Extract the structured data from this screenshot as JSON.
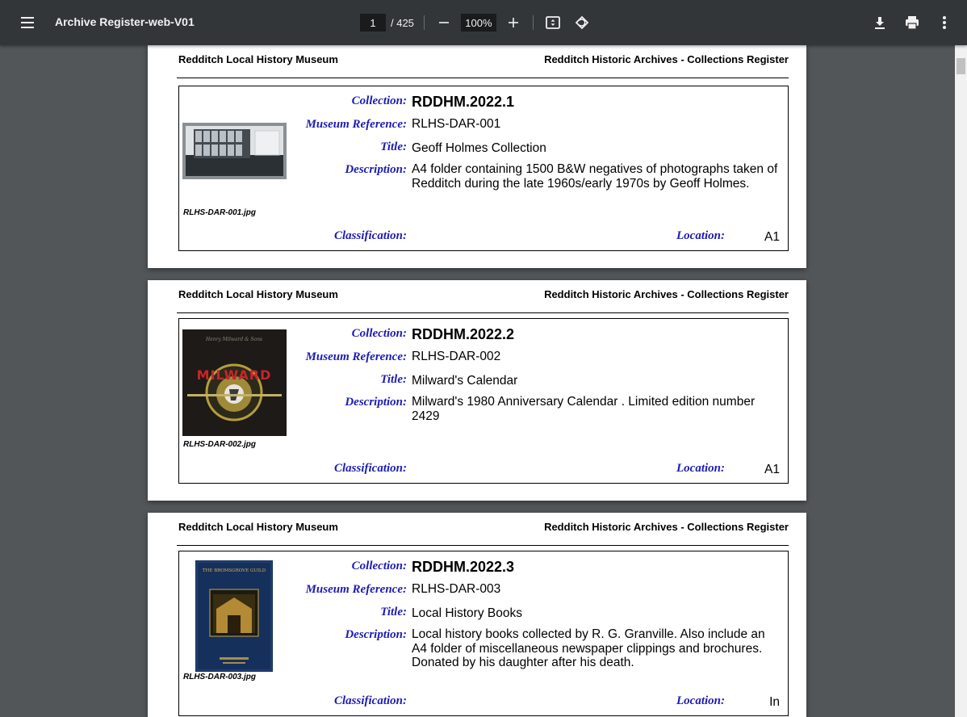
{
  "toolbar": {
    "title": "Archive Register-web-V01",
    "current_page": "1",
    "total_pages": "/ 425",
    "zoom": "100%"
  },
  "pages": [
    {
      "header_left": "Redditch Local History Museum",
      "header_right": "Redditch Historic Archives - Collections Register",
      "labels": {
        "collection": "Collection:",
        "museum_reference": "Museum Reference:",
        "title": "Title:",
        "description": "Description:",
        "classification": "Classification:",
        "location": "Location:"
      },
      "collection": "RDDHM.2022.1",
      "museum_reference": "RLHS-DAR-001",
      "title": "Geoff Holmes Collection",
      "description": "A4 folder containing 1500 B&W negatives of photographs taken of Redditch during the late 1960s/early 1970s by Geoff Holmes.",
      "image_name": "RLHS-DAR-001.jpg",
      "classification": "",
      "location": "A1"
    },
    {
      "header_left": "Redditch Local History Museum",
      "header_right": "Redditch Historic Archives - Collections Register",
      "labels": {
        "collection": "Collection:",
        "museum_reference": "Museum Reference:",
        "title": "Title:",
        "description": "Description:",
        "classification": "Classification:",
        "location": "Location:"
      },
      "collection": "RDDHM.2022.2",
      "museum_reference": "RLHS-DAR-002",
      "title": "Milward's Calendar",
      "description": "Milward's 1980 Anniversary Calendar . Limited edition number 2429",
      "image_name": "RLHS-DAR-002.jpg",
      "image_text": "MILWARD",
      "classification": "",
      "location": "A1"
    },
    {
      "header_left": "Redditch Local History Museum",
      "header_right": "Redditch Historic Archives - Collections Register",
      "labels": {
        "collection": "Collection:",
        "museum_reference": "Museum Reference:",
        "title": "Title:",
        "description": "Description:",
        "classification": "Classification:",
        "location": "Location:"
      },
      "collection": "RDDHM.2022.3",
      "museum_reference": "RLHS-DAR-003",
      "title": "Local History Books",
      "description": "Local history books collected by R. G. Granville.  Also include an A4 folder of miscellaneous newspaper clippings and brochures.  Donated by his daughter after his death.",
      "image_name": "RLHS-DAR-003.jpg",
      "image_text": "THE BROMSGROVE GUILD",
      "classification": "",
      "location": "In"
    }
  ]
}
